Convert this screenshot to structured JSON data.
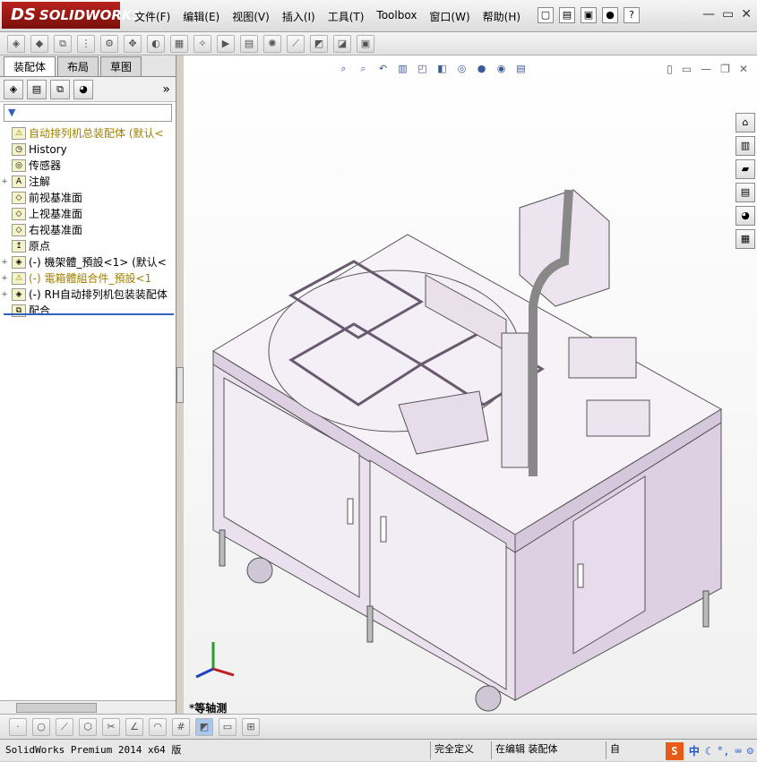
{
  "app": {
    "logo_text": "SOLIDWORKS",
    "logo_ds": "DS"
  },
  "menu": [
    "文件(F)",
    "编辑(E)",
    "视图(V)",
    "插入(I)",
    "工具(T)",
    "Toolbox",
    "窗口(W)",
    "帮助(H)"
  ],
  "panel": {
    "tabs": [
      "装配体",
      "布局",
      "草图"
    ],
    "more": "»",
    "filter_icon": "filter-icon",
    "tree": [
      {
        "label": "自动排列机总装配体 (默认<",
        "icon": "assembly-icon",
        "warn": true,
        "exp": ""
      },
      {
        "label": "History",
        "icon": "history-icon",
        "exp": ""
      },
      {
        "label": "传感器",
        "icon": "sensor-icon",
        "exp": ""
      },
      {
        "label": "注解",
        "icon": "annotation-icon",
        "exp": "+"
      },
      {
        "label": "前视基准面",
        "icon": "plane-icon",
        "exp": ""
      },
      {
        "label": "上视基准面",
        "icon": "plane-icon",
        "exp": ""
      },
      {
        "label": "右视基准面",
        "icon": "plane-icon",
        "exp": ""
      },
      {
        "label": "原点",
        "icon": "origin-icon",
        "exp": ""
      },
      {
        "label": "(-) 機架體_預設<1> (默认<",
        "icon": "part-icon",
        "exp": "+"
      },
      {
        "label": "(-) 電箱體組合件_預設<1",
        "icon": "part-icon",
        "warn": true,
        "exp": "+"
      },
      {
        "label": "(-) RH自动排列机包装装配体",
        "icon": "part-icon",
        "exp": "+"
      },
      {
        "label": "配合",
        "icon": "mate-icon",
        "exp": ""
      }
    ]
  },
  "viewport": {
    "view_name": "*等轴测"
  },
  "status": {
    "product": "SolidWorks Premium 2014 x64 版",
    "defined": "完全定义",
    "editing": "在编辑 装配体",
    "self": "自",
    "ime_char": "中"
  }
}
